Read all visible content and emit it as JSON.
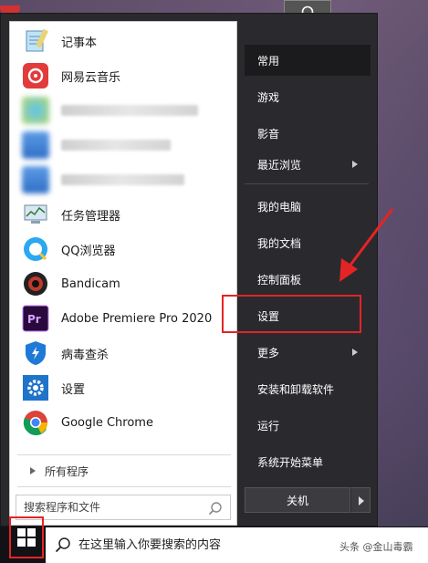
{
  "start_menu": {
    "apps": [
      {
        "label": "记事本",
        "icon": "notepad-icon",
        "blurred": false
      },
      {
        "label": "网易云音乐",
        "icon": "netease-music-icon",
        "blurred": false
      },
      {
        "label": "",
        "icon": "internet-explorer-icon",
        "blurred": true
      },
      {
        "label": "",
        "icon": "blurred-app-icon",
        "blurred": true
      },
      {
        "label": "",
        "icon": "blurred-app-icon",
        "blurred": true
      },
      {
        "label": "任务管理器",
        "icon": "task-manager-icon",
        "blurred": false
      },
      {
        "label": "QQ浏览器",
        "icon": "qq-browser-icon",
        "blurred": false
      },
      {
        "label": "Bandicam",
        "icon": "bandicam-icon",
        "blurred": false
      },
      {
        "label": "Adobe Premiere Pro 2020",
        "icon": "premiere-pro-icon",
        "blurred": false
      },
      {
        "label": "病毒查杀",
        "icon": "antivirus-shield-icon",
        "blurred": false
      },
      {
        "label": "设置",
        "icon": "settings-gear-icon",
        "blurred": false
      },
      {
        "label": "Google Chrome",
        "icon": "chrome-icon",
        "blurred": false
      }
    ],
    "all_programs_label": "所有程序",
    "search_placeholder": "搜索程序和文件",
    "right_items": [
      {
        "label": "常用",
        "active": true,
        "has_arrow": false
      },
      {
        "label": "游戏",
        "active": false,
        "has_arrow": false
      },
      {
        "label": "影音",
        "active": false,
        "has_arrow": false
      },
      {
        "label": "最近浏览",
        "active": false,
        "has_arrow": true
      },
      {
        "label": "我的电脑",
        "active": false,
        "has_arrow": false
      },
      {
        "label": "我的文档",
        "active": false,
        "has_arrow": false
      },
      {
        "label": "控制面板",
        "active": false,
        "has_arrow": false
      },
      {
        "label": "设置",
        "active": false,
        "has_arrow": false
      },
      {
        "label": "更多",
        "active": false,
        "has_arrow": true
      },
      {
        "label": "安装和卸载软件",
        "active": false,
        "has_arrow": false
      },
      {
        "label": "运行",
        "active": false,
        "has_arrow": false
      },
      {
        "label": "系统开始菜单",
        "active": false,
        "has_arrow": false
      }
    ],
    "shutdown_label": "关机"
  },
  "taskbar": {
    "search_placeholder": "在这里输入你要搜索的内容",
    "watermark": "头条 @金山毒霸"
  },
  "colors": {
    "highlight": "#e42424",
    "menu_bg": "#2a2a2e",
    "taskbar_bg": "#111116"
  }
}
